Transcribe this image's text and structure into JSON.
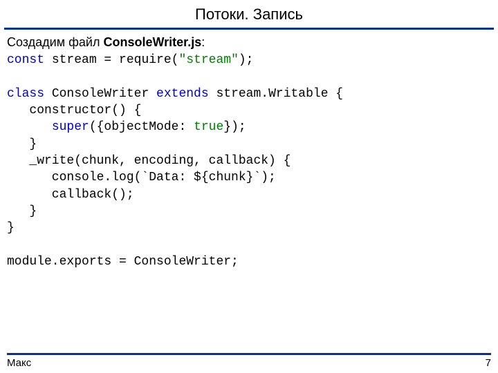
{
  "title": "Потоки. Запись",
  "intro_prefix": "Создадим файл ",
  "intro_filename": "ConsoleWriter.js",
  "intro_suffix": ":",
  "code": {
    "l1_kw": "const",
    "l1_rest": " stream = require(",
    "l1_str": "\"stream\"",
    "l1_end": ");",
    "l2": "",
    "l3_kw1": "class",
    "l3_mid": " ConsoleWriter ",
    "l3_kw2": "extends",
    "l3_end": " stream.Writable {",
    "l4": "   constructor() {",
    "l5_pre": "      ",
    "l5_super": "super",
    "l5_mid": "({objectMode: ",
    "l5_true": "true",
    "l5_end": "});",
    "l6": "   }",
    "l7": "   _write(chunk, encoding, callback) {",
    "l8": "      console.log(`Data: ${chunk}`);",
    "l9": "      callback();",
    "l10": "   }",
    "l11": "}",
    "l12": "",
    "l13": "module.exports = ConsoleWriter;"
  },
  "footer": {
    "author": "Макс",
    "page": "7"
  }
}
